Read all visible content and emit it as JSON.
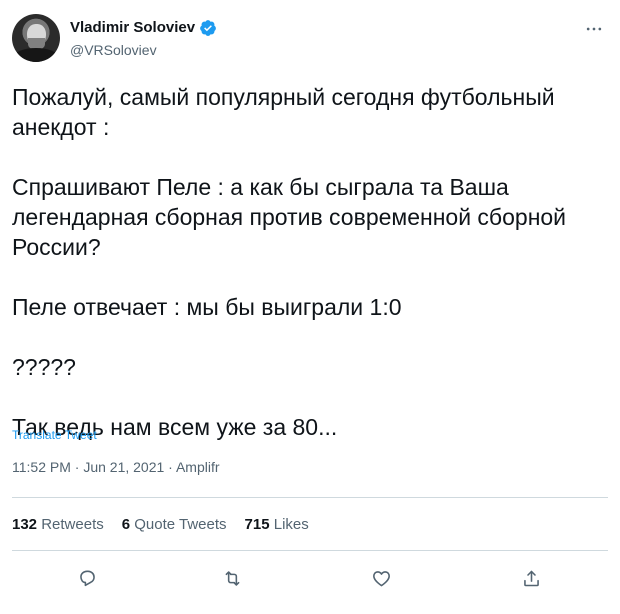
{
  "author": {
    "name": "Vladimir Soloviev",
    "handle": "@VRSoloviev",
    "verified": true
  },
  "tweet": {
    "lines": [
      "Пожалуй, самый популярный сегодня футбольный анекдот :",
      "Спрашивают Пеле : а как бы сыграла та Ваша легендарная сборная против современной сборной России?",
      "Пеле отвечает : мы бы выиграли 1:0",
      "?????",
      "Так ведь нам всем  уже за  80..."
    ],
    "translate_label": "Translate Tweet",
    "meta": "11:52 PM · Jun 21, 2021 · Amplifr"
  },
  "stats": {
    "retweets": {
      "count": "132",
      "label": "Retweets"
    },
    "quotes": {
      "count": "6",
      "label": "Quote Tweets"
    },
    "likes": {
      "count": "715",
      "label": "Likes"
    }
  },
  "icons": {
    "reply": "reply-icon",
    "retweet": "retweet-icon",
    "like": "like-icon",
    "share": "share-icon",
    "more": "more-icon",
    "verified": "verified-badge-icon"
  },
  "colors": {
    "accent": "#1d9bf0",
    "text": "#0f1419",
    "muted": "#536471",
    "divider": "#cfd9de"
  }
}
